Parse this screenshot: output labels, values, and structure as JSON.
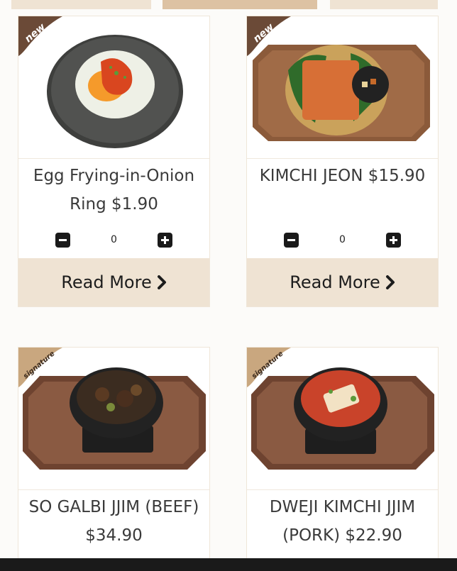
{
  "products": [
    {
      "name": "Egg Frying-in-Onion Ring $1.90",
      "badge": "new",
      "quantity": "0",
      "read_more_label": "Read More"
    },
    {
      "name": "KIMCHI JEON $15.90",
      "badge": "new",
      "quantity": "0",
      "read_more_label": "Read More"
    },
    {
      "name": "SO GALBI JJIM (BEEF) $34.90",
      "badge": "signature"
    },
    {
      "name": "DWEJI KIMCHI JJIM (PORK) $22.90",
      "badge": "signature"
    }
  ],
  "icons": {
    "decrease": "minus-icon",
    "increase": "plus-icon",
    "read_more": "chevron-right-icon"
  },
  "colors": {
    "accent_beige": "#efe3d3",
    "badge_brown": "#6b4a37",
    "badge_tan": "#c9a77f"
  }
}
